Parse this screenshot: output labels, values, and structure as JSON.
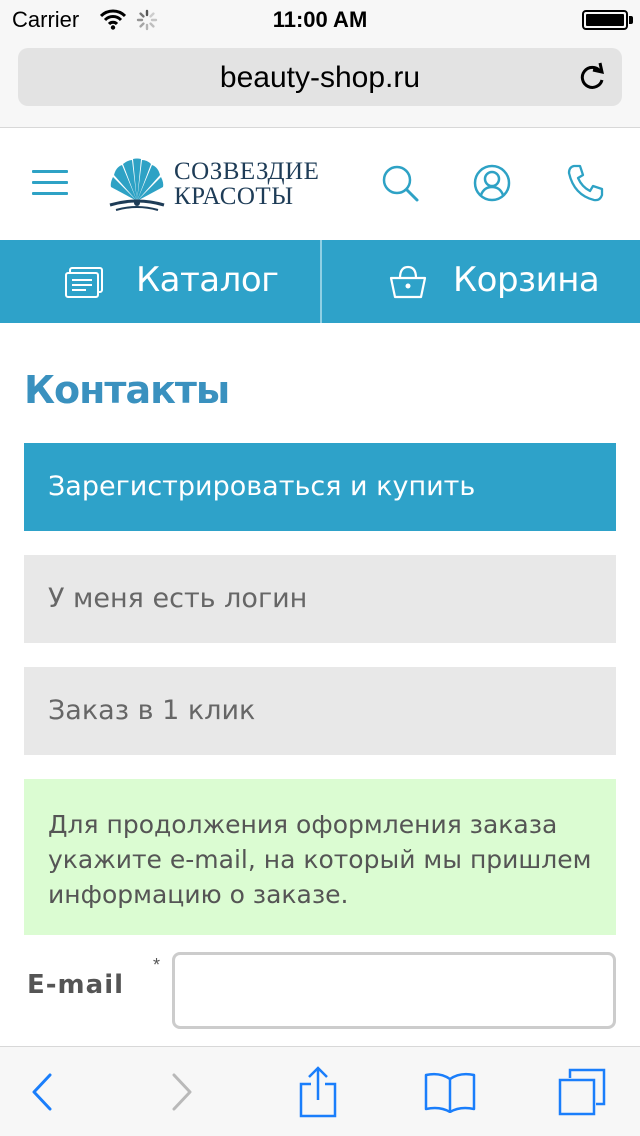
{
  "status_bar": {
    "carrier": "Carrier",
    "time": "11:00 AM"
  },
  "browser": {
    "url": "beauty-shop.ru"
  },
  "header": {
    "logo_line1": "СОЗВЕЗДИЕ",
    "logo_line2": "КРАСОТЫ",
    "icons": [
      "menu-icon",
      "search-icon",
      "user-icon",
      "phone-icon"
    ]
  },
  "nav": {
    "catalog_label": "Каталог",
    "cart_label": "Корзина"
  },
  "page": {
    "title": "Контакты",
    "register_button": "Зарегистрироваться и купить",
    "login_button": "У меня есть логин",
    "oneclick_button": "Заказ в 1 клик",
    "notice_text": "Для продолжения оформления заказа укажите e-mail, на который мы пришлем информацию о заказе.",
    "email_label": "E-mail",
    "required_mark": "*",
    "email_value": ""
  },
  "toolbar": {
    "icons": [
      "back-icon",
      "forward-icon",
      "share-icon",
      "bookmarks-icon",
      "tabs-icon"
    ]
  },
  "colors": {
    "accent": "#2ea2c9",
    "title": "#3a91bf",
    "notice_bg": "#dbfcd2",
    "secondary_button_bg": "#e8e8e8",
    "ios_blue": "#1a7efb"
  }
}
